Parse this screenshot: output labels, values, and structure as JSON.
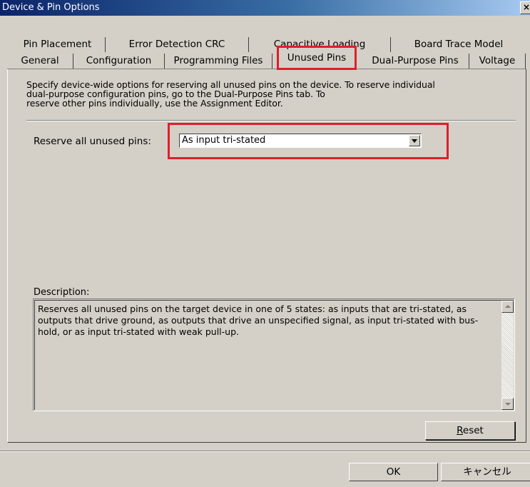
{
  "window": {
    "title": "Device & Pin Options"
  },
  "tabs_row1": [
    {
      "label": "Pin Placement"
    },
    {
      "label": "Error Detection CRC"
    },
    {
      "label": "Capacitive Loading"
    },
    {
      "label": "Board Trace Model"
    }
  ],
  "tabs_row2": [
    {
      "label": "General"
    },
    {
      "label": "Configuration"
    },
    {
      "label": "Programming Files"
    },
    {
      "label": "Unused Pins"
    },
    {
      "label": "Dual-Purpose Pins"
    },
    {
      "label": "Voltage"
    }
  ],
  "active_tab": "Unused Pins",
  "panel": {
    "intro_line1": "Specify device-wide options for reserving all unused pins on the device. To reserve individual",
    "intro_line2": "dual-purpose configuration pins, go to the Dual-Purpose Pins tab. To",
    "intro_line3": "reserve other pins individually, use the Assignment Editor.",
    "reserve_label": "Reserve all unused pins:",
    "reserve_value": "As input tri-stated",
    "description_label": "Description:",
    "description_text": "Reserves all unused pins on the target device in one of 5 states: as inputs that are tri-stated, as outputs that drive ground, as outputs that drive an unspecified signal, as input tri-stated with bus-hold, or as input tri-stated with weak pull-up.",
    "reset_label_prefix": "",
    "reset_label_accel": "R",
    "reset_label_rest": "eset"
  },
  "buttons": {
    "ok": "OK",
    "cancel": "キャンセル"
  },
  "colors": {
    "highlight": "#e01e2a",
    "titlebar": "#0a246a",
    "dialog": "#d4d0c8"
  },
  "icons": {
    "close": "close-icon",
    "dropdown": "chevron-down-icon"
  }
}
